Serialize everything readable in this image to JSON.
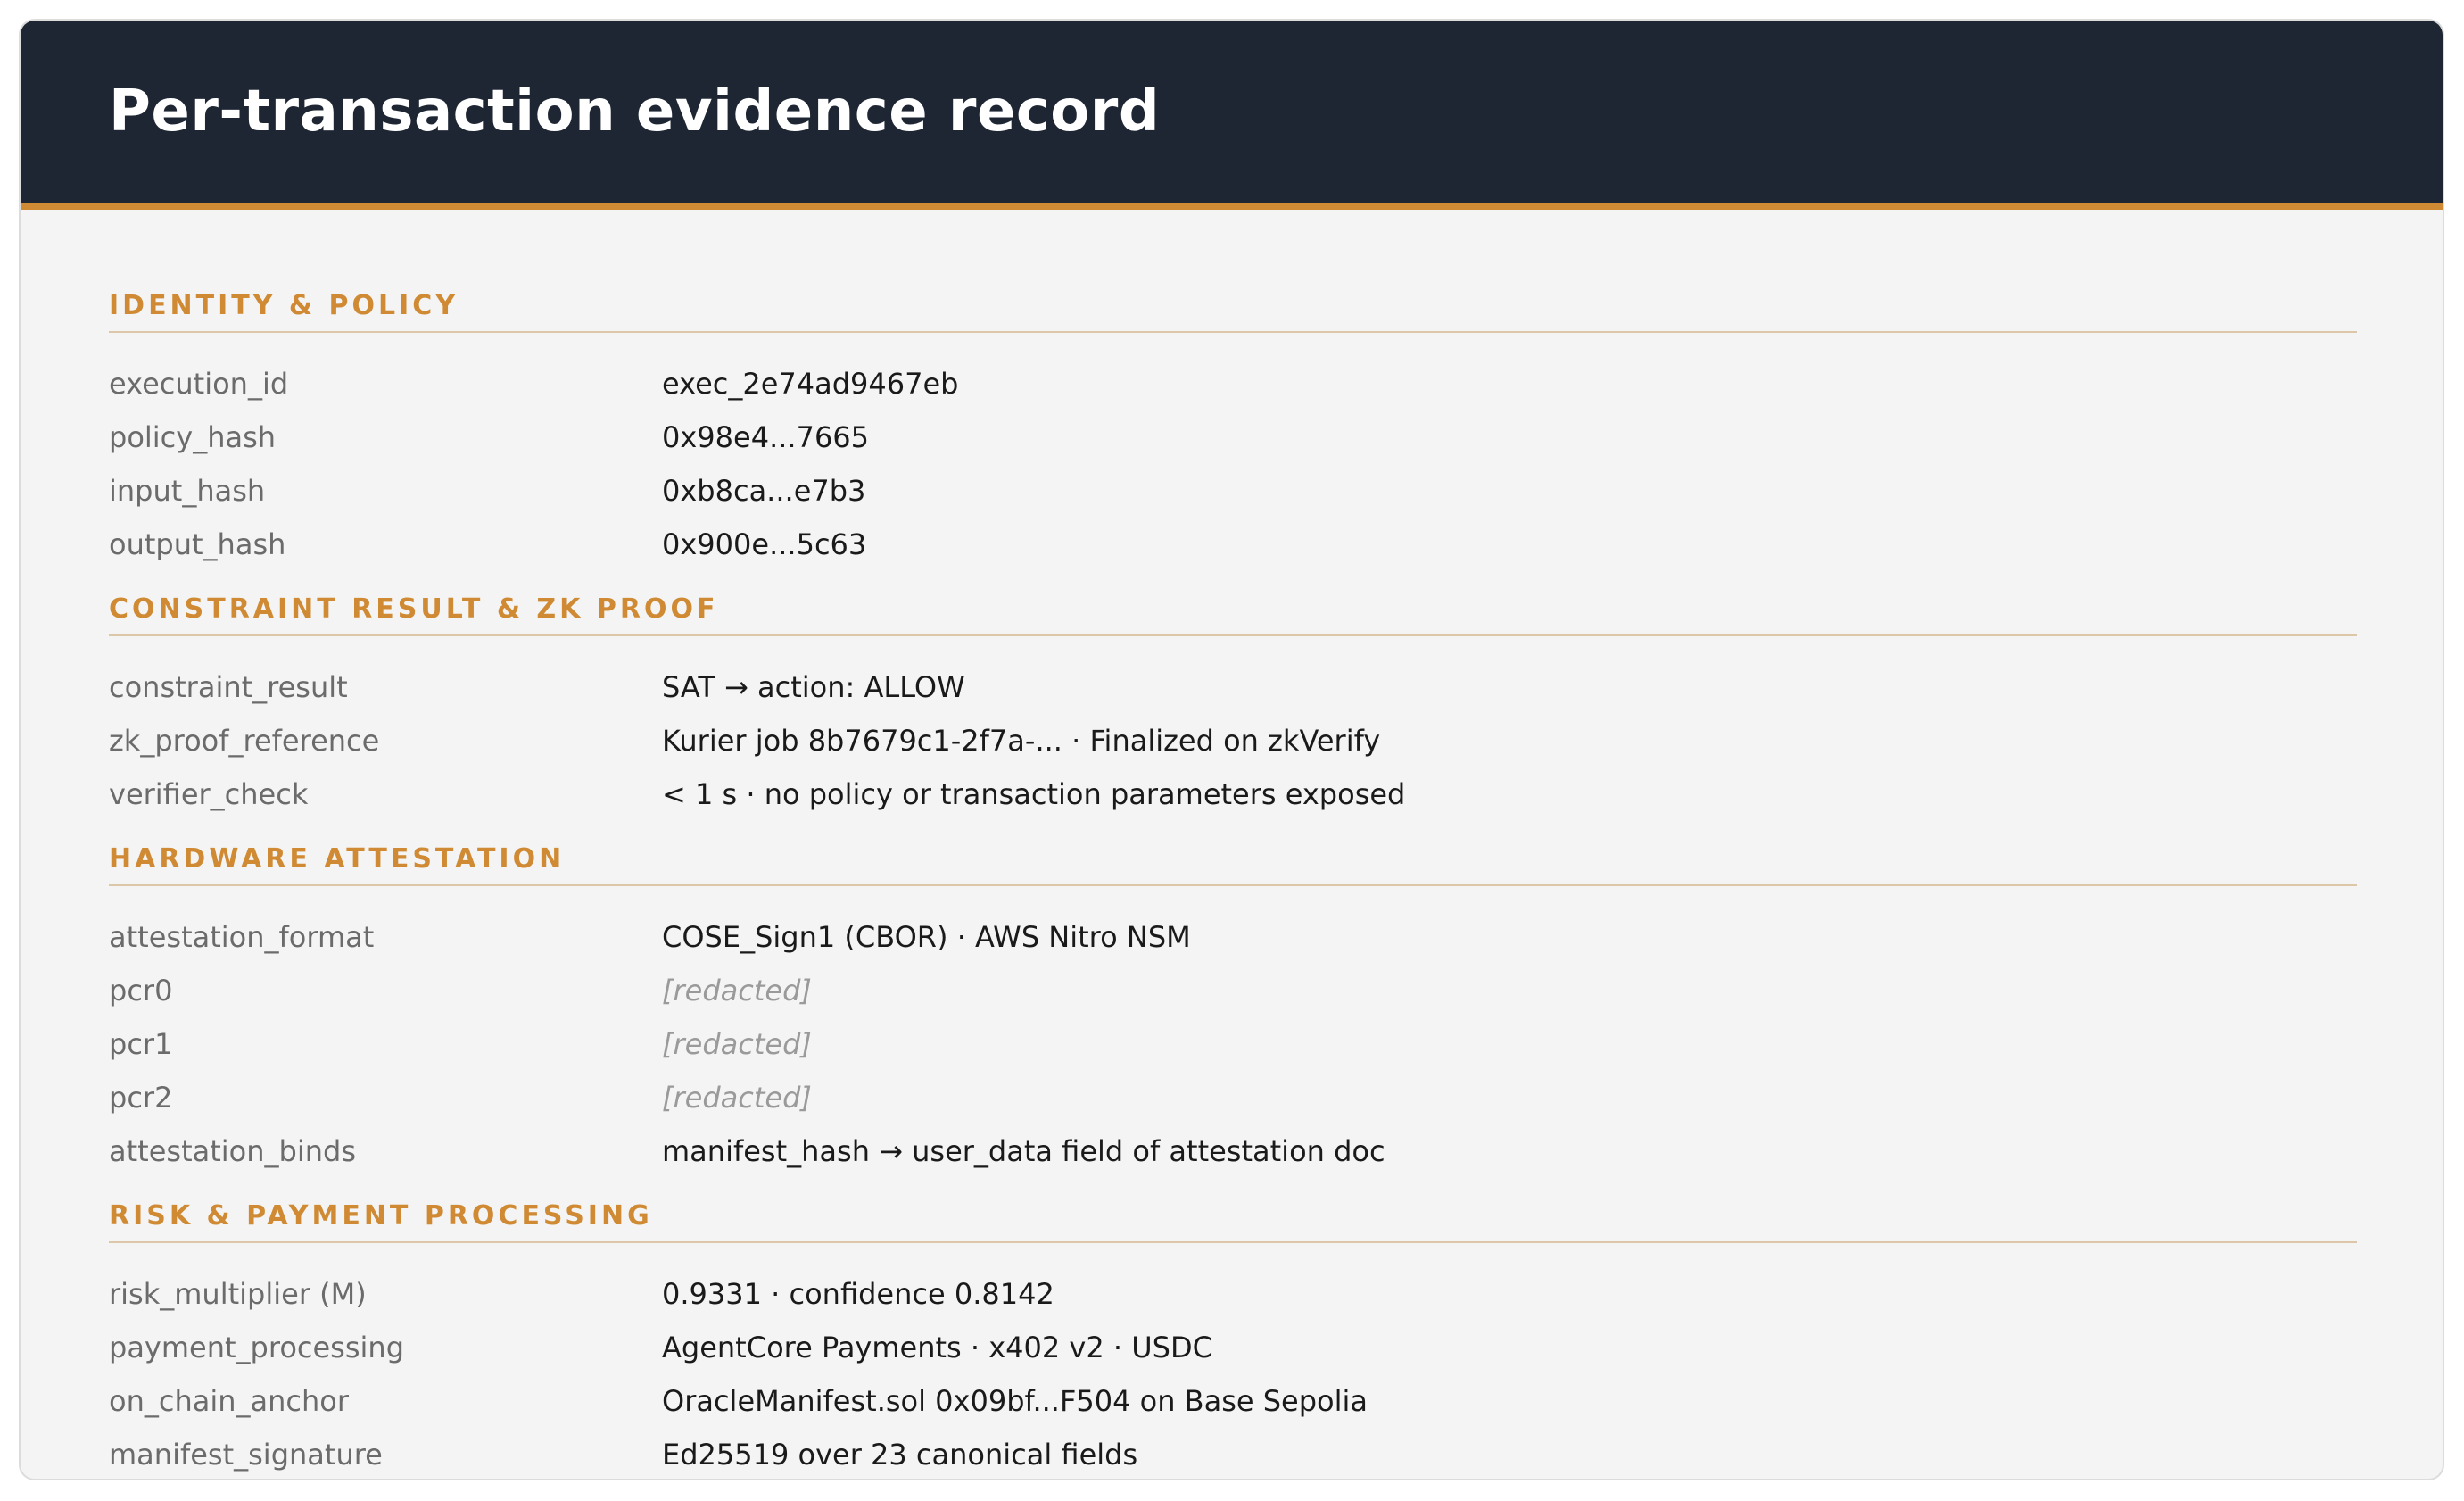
{
  "page": {
    "title": "Per-transaction evidence record"
  },
  "colors": {
    "header_bg": "#1e2633",
    "accent": "#cf8a33",
    "card_bg": "#f4f4f4",
    "key_text": "#6b6b6b",
    "value_text": "#1a1a1a",
    "redacted_text": "#9a9a9a"
  },
  "sections": [
    {
      "title": "IDENTITY & POLICY",
      "rows": [
        {
          "key": "execution_id",
          "value": "exec_2e74ad9467eb"
        },
        {
          "key": "policy_hash",
          "value": "0x98e4...7665"
        },
        {
          "key": "input_hash",
          "value": "0xb8ca...e7b3"
        },
        {
          "key": "output_hash",
          "value": "0x900e...5c63"
        }
      ]
    },
    {
      "title": "CONSTRAINT RESULT & ZK PROOF",
      "rows": [
        {
          "key": "constraint_result",
          "value": "SAT → action: ALLOW"
        },
        {
          "key": "zk_proof_reference",
          "value": "Kurier job 8b7679c1-2f7a-... · Finalized on zkVerify"
        },
        {
          "key": "verifier_check",
          "value": "< 1 s · no policy or transaction parameters exposed"
        }
      ]
    },
    {
      "title": "HARDWARE ATTESTATION",
      "rows": [
        {
          "key": "attestation_format",
          "value": "COSE_Sign1 (CBOR) · AWS Nitro NSM"
        },
        {
          "key": "pcr0",
          "value": "[redacted]"
        },
        {
          "key": "pcr1",
          "value": "[redacted]"
        },
        {
          "key": "pcr2",
          "value": "[redacted]"
        },
        {
          "key": "attestation_binds",
          "value": "manifest_hash → user_data field of attestation doc"
        }
      ]
    },
    {
      "title": "RISK & PAYMENT PROCESSING",
      "rows": [
        {
          "key": "risk_multiplier (M)",
          "value": "0.9331 · confidence 0.8142"
        },
        {
          "key": "payment_processing",
          "value": "AgentCore Payments · x402 v2 · USDC"
        },
        {
          "key": "on_chain_anchor",
          "value": "OracleManifest.sol 0x09bf...F504 on Base Sepolia"
        },
        {
          "key": "manifest_signature",
          "value": "Ed25519 over 23 canonical fields"
        }
      ]
    }
  ]
}
